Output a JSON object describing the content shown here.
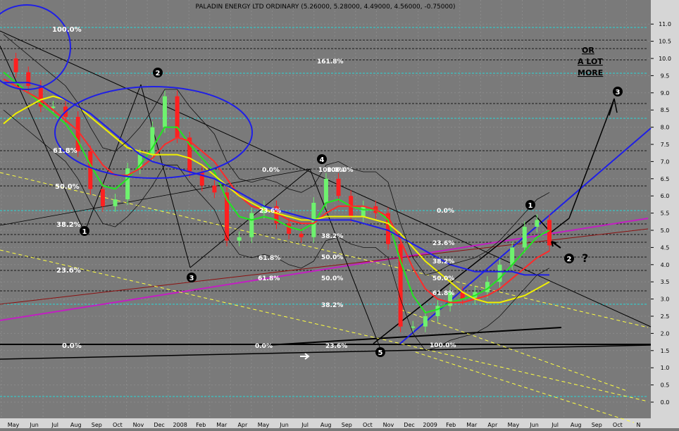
{
  "chart_data": {
    "type": "line",
    "title": "PALADIN ENERGY LTD ORDINARY (5.26000, 5.28000, 4.49000, 4.56000, -0.75000)",
    "ylim": [
      -0.25,
      11.25
    ],
    "y_ticks": [
      "0.0",
      "0.5",
      "1.0",
      "1.5",
      "2.0",
      "2.5",
      "3.0",
      "3.5",
      "4.0",
      "4.5",
      "5.0",
      "5.5",
      "6.0",
      "6.5",
      "7.0",
      "7.5",
      "8.0",
      "8.5",
      "9.0",
      "9.5",
      "10.0",
      "10.5",
      "11.0"
    ],
    "x_ticks": [
      "May",
      "Jun",
      "Jul",
      "Aug",
      "Sep",
      "Oct",
      "Nov",
      "Dec",
      "2008",
      "Feb",
      "Mar",
      "Apr",
      "May",
      "Jun",
      "Jul",
      "Aug",
      "Sep",
      "Oct",
      "Nov",
      "Dec",
      "2009",
      "Feb",
      "Mar",
      "Apr",
      "May",
      "Jun",
      "Jul",
      "Aug",
      "Sep",
      "Oct",
      "N"
    ],
    "grid": true,
    "series": [
      {
        "color": "#ff2020",
        "values": [
          10.0,
          9.6,
          9.2,
          8.6,
          8.6,
          8.3,
          7.3,
          6.2,
          5.7,
          5.9,
          6.8,
          7.2,
          8.0,
          8.9,
          7.7,
          6.7,
          6.3,
          6.1,
          4.7,
          4.8,
          5.5,
          5.7,
          5.2,
          4.9,
          4.8,
          5.8,
          6.5,
          6.0,
          5.4,
          5.7,
          5.5,
          4.6,
          2.2,
          2.2,
          2.5,
          2.8,
          3.2,
          3.0,
          3.2,
          3.5,
          4.0,
          4.5,
          5.1,
          5.3,
          4.56
        ]
      },
      {
        "color": "#21e621",
        "values": [
          9.6,
          9.3,
          9.0,
          8.7,
          8.4,
          8.1,
          7.6,
          6.9,
          6.3,
          6.2,
          6.5,
          6.9,
          7.4,
          8.0,
          8.0,
          7.5,
          7.1,
          6.7,
          5.9,
          5.4,
          5.3,
          5.4,
          5.3,
          5.1,
          5.0,
          5.2,
          5.8,
          5.9,
          5.7,
          5.6,
          5.6,
          5.3,
          4.1,
          3.1,
          2.6,
          2.7,
          2.9,
          3.0,
          3.1,
          3.3,
          3.6,
          4.0,
          4.4,
          4.8,
          5.0
        ]
      },
      {
        "color": "#ff2a2a",
        "values": [
          9.4,
          9.2,
          9.0,
          8.8,
          8.5,
          8.2,
          7.9,
          7.4,
          6.9,
          6.6,
          6.6,
          6.8,
          7.1,
          7.5,
          7.7,
          7.6,
          7.3,
          7.0,
          6.5,
          6.0,
          5.7,
          5.6,
          5.5,
          5.3,
          5.2,
          5.2,
          5.5,
          5.7,
          5.7,
          5.7,
          5.6,
          5.4,
          4.7,
          3.9,
          3.3,
          3.0,
          2.9,
          2.9,
          3.0,
          3.1,
          3.3,
          3.6,
          3.9,
          4.2,
          4.4
        ]
      },
      {
        "color": "#f0f000",
        "values": [
          8.1,
          8.4,
          8.6,
          8.8,
          8.9,
          8.8,
          8.6,
          8.3,
          8.0,
          7.7,
          7.4,
          7.3,
          7.2,
          7.2,
          7.2,
          7.1,
          6.9,
          6.6,
          6.3,
          6.0,
          5.8,
          5.6,
          5.5,
          5.4,
          5.3,
          5.3,
          5.4,
          5.4,
          5.4,
          5.4,
          5.3,
          5.2,
          4.9,
          4.5,
          4.1,
          3.8,
          3.5,
          3.2,
          3.0,
          2.9,
          2.9,
          3.0,
          3.1,
          3.3,
          3.5
        ]
      },
      {
        "color": "#1f1fe6",
        "values": [
          9.3,
          9.3,
          9.3,
          9.2,
          9.0,
          8.8,
          8.6,
          8.4,
          8.1,
          7.8,
          7.5,
          7.2,
          7.0,
          6.9,
          6.8,
          6.7,
          6.6,
          6.5,
          6.3,
          6.1,
          5.9,
          5.7,
          5.6,
          5.5,
          5.4,
          5.3,
          5.3,
          5.3,
          5.3,
          5.2,
          5.1,
          5.0,
          4.8,
          4.6,
          4.4,
          4.2,
          4.0,
          3.9,
          3.8,
          3.8,
          3.8,
          3.8,
          3.7,
          3.7,
          3.7
        ]
      }
    ],
    "fib_labels_left": [
      "100.0%",
      "61.8%",
      "50.0%",
      "38.2%",
      "23.6%",
      "0.0%"
    ],
    "fib_labels_mid": [
      "161.8%",
      "0.0%",
      "100.0%",
      "23.6%",
      "38.2%",
      "61.8%",
      "50.0%",
      "61.8%",
      "50.0%",
      "38.2%",
      "23.6%",
      "0.0%",
      "100.0%"
    ],
    "fib_labels_right": [
      "0.0%",
      "23.6%",
      "38.2%",
      "50.0%",
      "61.8%",
      "100.0%"
    ],
    "wave_labels": [
      "1",
      "2",
      "3",
      "4",
      "5",
      "1",
      "2",
      "3"
    ],
    "annotations": [
      "OR",
      "A LOT",
      "MORE",
      "?"
    ]
  }
}
